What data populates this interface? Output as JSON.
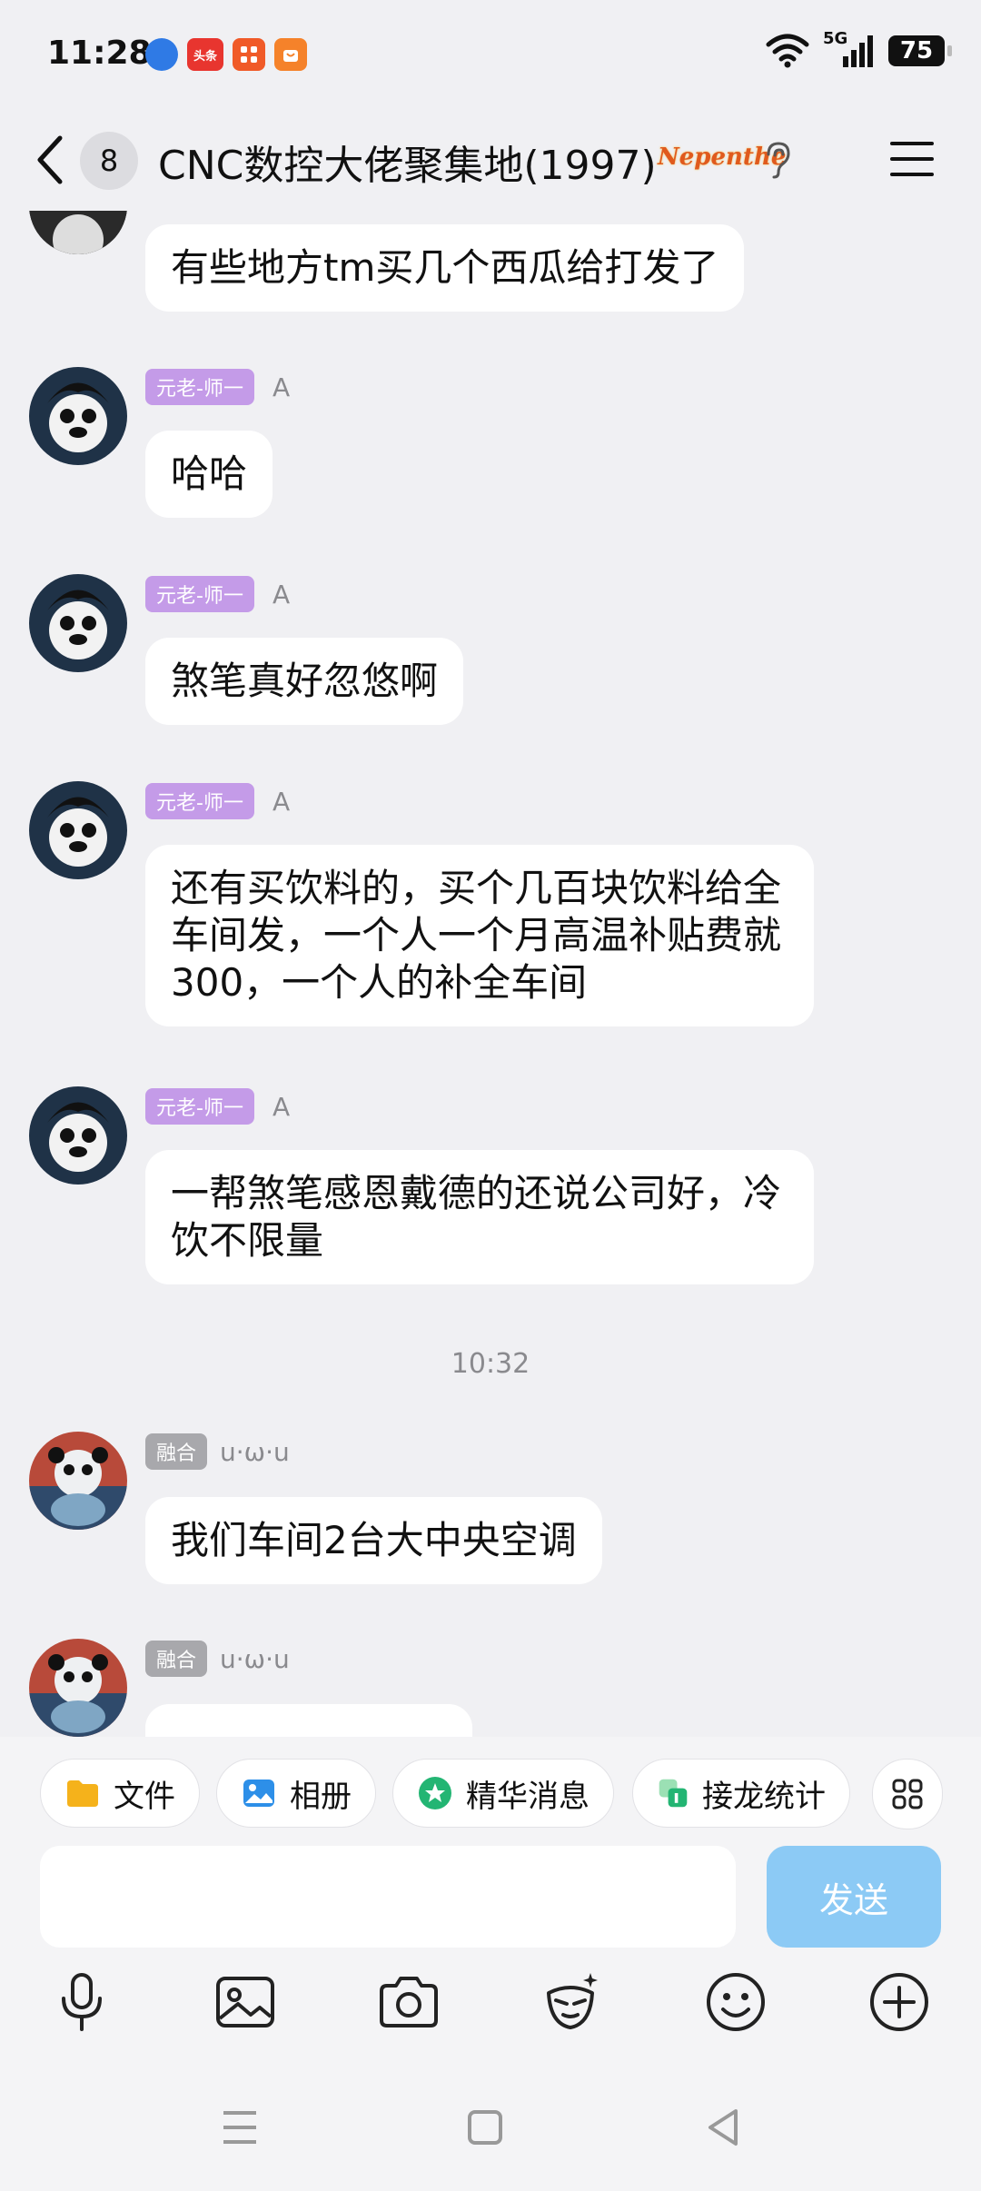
{
  "status_bar": {
    "time": "11:28",
    "network": "5G",
    "battery": "75",
    "app_badge": "头条"
  },
  "header": {
    "unread_count": "8",
    "title": "CNC数控大佬聚集地(1997)",
    "badge_text": "Nepenthe"
  },
  "messages": [
    {
      "text": "有些地方tm买几个西瓜给打发了"
    },
    {
      "tag": "元老-师一",
      "sender": "A",
      "text": "哈哈"
    },
    {
      "tag": "元老-师一",
      "sender": "A",
      "text": "煞笔真好忽悠啊"
    },
    {
      "tag": "元老-师一",
      "sender": "A",
      "text": "还有买饮料的，买个几百块饮料给全车间发，一个人一个月高温补贴费就300，一个人的补全车间"
    },
    {
      "tag": "元老-师一",
      "sender": "A",
      "text": "一帮煞笔感恩戴德的还说公司好，冷饮不限量"
    },
    {
      "tag": "融合",
      "sender": "u·ω·u",
      "text": "我们车间2台大中央空调"
    },
    {
      "tag": "融合",
      "sender": "u·ω·u",
      "text": ""
    }
  ],
  "time_divider": "10:32",
  "quick_actions": {
    "file": "文件",
    "album": "相册",
    "highlights": "精华消息",
    "relay": "接龙统计"
  },
  "input": {
    "placeholder": "",
    "send": "发送"
  },
  "colors": {
    "accent": "#8ccaf5",
    "tag_purple": "#c49be8",
    "tag_gray": "#a8a8ac"
  }
}
